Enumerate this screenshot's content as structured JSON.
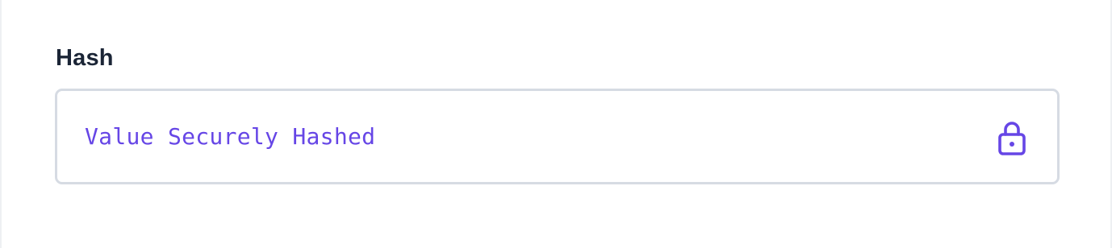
{
  "field": {
    "label": "Hash",
    "value": "Value Securely Hashed",
    "icon": "lock-icon"
  },
  "colors": {
    "accent": "#6646e6",
    "label_text": "#1b2536",
    "border": "#d6dbe3"
  }
}
